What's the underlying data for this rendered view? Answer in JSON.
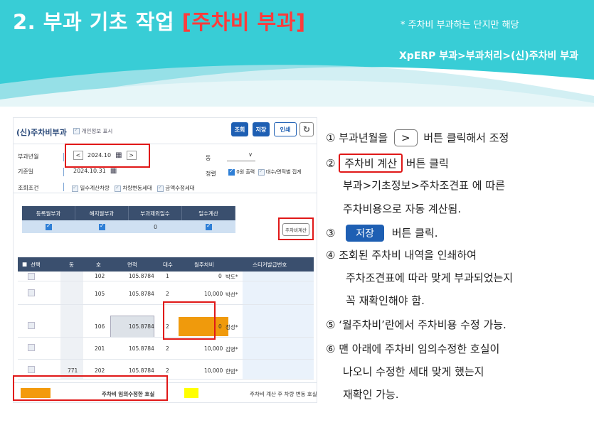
{
  "header": {
    "title_prefix": "2. 부과 기초 작업 ",
    "title_highlight": "[주차비 부과]",
    "note": "* 주차비 부과하는 단지만 해당",
    "menu_path": "XpERP 부과>부과처리>(신)주차비 부과"
  },
  "app": {
    "title": "(신)주차비부과",
    "show_info_label": "개인정보 표시",
    "toolbar": {
      "query": "조회",
      "save": "저장",
      "print": "인쇄",
      "refresh": "↻"
    },
    "filters": {
      "period_label": "부과년월",
      "period_value": "2024.10",
      "prev": "<",
      "next": ">",
      "base_date_label": "기준일",
      "base_date_value": "2024.10.31",
      "condition_label": "조회조건",
      "conditions": [
        "일수계산차량",
        "차량변동세대",
        "금액수정세대"
      ],
      "dong_label": "동",
      "dong_value": "∨",
      "sort_label": "정렬",
      "sort_options": [
        "0원 출력",
        "대수/면적별 집계"
      ]
    },
    "summary": {
      "headers": [
        "등록월부과",
        "해지월부과",
        "부과제외일수",
        "일수계산"
      ],
      "values": [
        "",
        "",
        "0",
        ""
      ]
    },
    "calc_button": "주차비계산",
    "grid": {
      "headers": [
        "선택",
        "동",
        "호",
        "면적",
        "대수",
        "월주차비",
        "스티커발급번호"
      ],
      "rows": [
        {
          "dong": "",
          "ho": "102",
          "area": "105.8784",
          "cars": "1",
          "fee": "0",
          "note": "박도*"
        },
        {
          "dong": "",
          "ho": "105",
          "area": "105.8784",
          "cars": "2",
          "fee": "10,000",
          "note": "박선*"
        },
        {
          "dong": "",
          "ho": "106",
          "area": "105.8784",
          "cars": "2",
          "fee": "0",
          "note": "정성*"
        },
        {
          "dong": "",
          "ho": "201",
          "area": "105.8784",
          "cars": "2",
          "fee": "10,000",
          "note": "김병*"
        },
        {
          "dong": "771",
          "ho": "202",
          "area": "105.8784",
          "cars": "2",
          "fee": "10,000",
          "note": "한범*"
        }
      ]
    },
    "legend": {
      "orange": "주차비 임의수정한 호실",
      "yellow": "주차비 계산 후 차량 변동 호실"
    }
  },
  "steps": {
    "s1_pre": "① 부과년월을",
    "s1_btn": ">",
    "s1_post": "버튼 클릭해서 조정",
    "s2_pre": "②",
    "s2_btn": "주차비 계산",
    "s2_post": "버튼 클릭",
    "s2_line2": "부과>기초정보>주차조견표 에 따른",
    "s2_line3": "주차비용으로 자동 계산됨.",
    "s3_pre": "③",
    "s3_btn": "저장",
    "s3_post": "버튼 클릭.",
    "s4_line1": "④  조회된 주차비 내역을 인쇄하여",
    "s4_line2": "주차조견표에 따라 맞게 부과되었는지",
    "s4_line3": "꼭 재확인해야 함.",
    "s5": "⑤ ‘월주차비’란에서 주차비용 수정 가능.",
    "s6_line1": "⑥ 맨 아래에 주차비 임의수정한 호실이",
    "s6_line2": "나오니 수정한 세대 맞게 했는지",
    "s6_line3": "재확인 가능."
  },
  "colors": {
    "banner": "#3fd0d8",
    "highlight_red": "#ff3b3b",
    "button_blue": "#1e5fb3",
    "orange": "#f09a0c",
    "yellow": "#ffff00"
  }
}
